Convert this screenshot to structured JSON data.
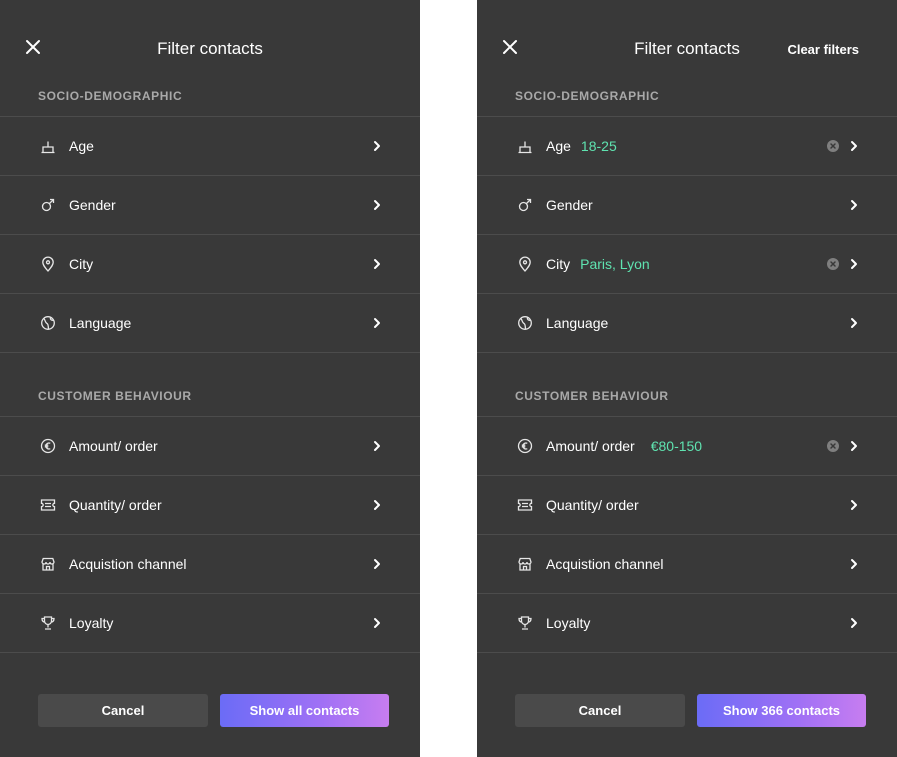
{
  "colors": {
    "panel_bg": "#393939",
    "divider": "#4c4c4c",
    "section": "#a9a9a9",
    "accent_value": "#5fe3b0",
    "button_gradient_start": "#6b6cf6",
    "button_gradient_end": "#c77df0",
    "cancel_bg": "#4a4a4a"
  },
  "left": {
    "title": "Filter contacts",
    "section1": "SOCIO-DEMOGRAPHIC",
    "section2": "CUSTOMER BEHAVIOUR",
    "items": [
      {
        "label": "Age",
        "icon": "cake-icon",
        "value": ""
      },
      {
        "label": "Gender",
        "icon": "male-gender-icon",
        "value": ""
      },
      {
        "label": "City",
        "icon": "location-pin-icon",
        "value": ""
      },
      {
        "label": "Language",
        "icon": "globe-icon",
        "value": ""
      },
      {
        "label": "Amount/ order",
        "icon": "euro-icon",
        "value": ""
      },
      {
        "label": "Quantity/ order",
        "icon": "ticket-icon",
        "value": ""
      },
      {
        "label": "Acquistion channel",
        "icon": "store-icon",
        "value": ""
      },
      {
        "label": "Loyalty",
        "icon": "trophy-icon",
        "value": ""
      }
    ],
    "cancel": "Cancel",
    "show": "Show all contacts"
  },
  "right": {
    "title": "Filter contacts",
    "clear": "Clear filters",
    "section1": "SOCIO-DEMOGRAPHIC",
    "section2": "CUSTOMER BEHAVIOUR",
    "items": [
      {
        "label": "Age",
        "icon": "cake-icon",
        "value": "18-25"
      },
      {
        "label": "Gender",
        "icon": "male-gender-icon",
        "value": ""
      },
      {
        "label": "City",
        "icon": "location-pin-icon",
        "value": "Paris, Lyon"
      },
      {
        "label": "Language",
        "icon": "globe-icon",
        "value": ""
      },
      {
        "label": "Amount/ order",
        "icon": "euro-icon",
        "value": "€80-150"
      },
      {
        "label": "Quantity/ order",
        "icon": "ticket-icon",
        "value": ""
      },
      {
        "label": "Acquistion channel",
        "icon": "store-icon",
        "value": ""
      },
      {
        "label": "Loyalty",
        "icon": "trophy-icon",
        "value": ""
      }
    ],
    "cancel": "Cancel",
    "show": "Show 366 contacts"
  }
}
